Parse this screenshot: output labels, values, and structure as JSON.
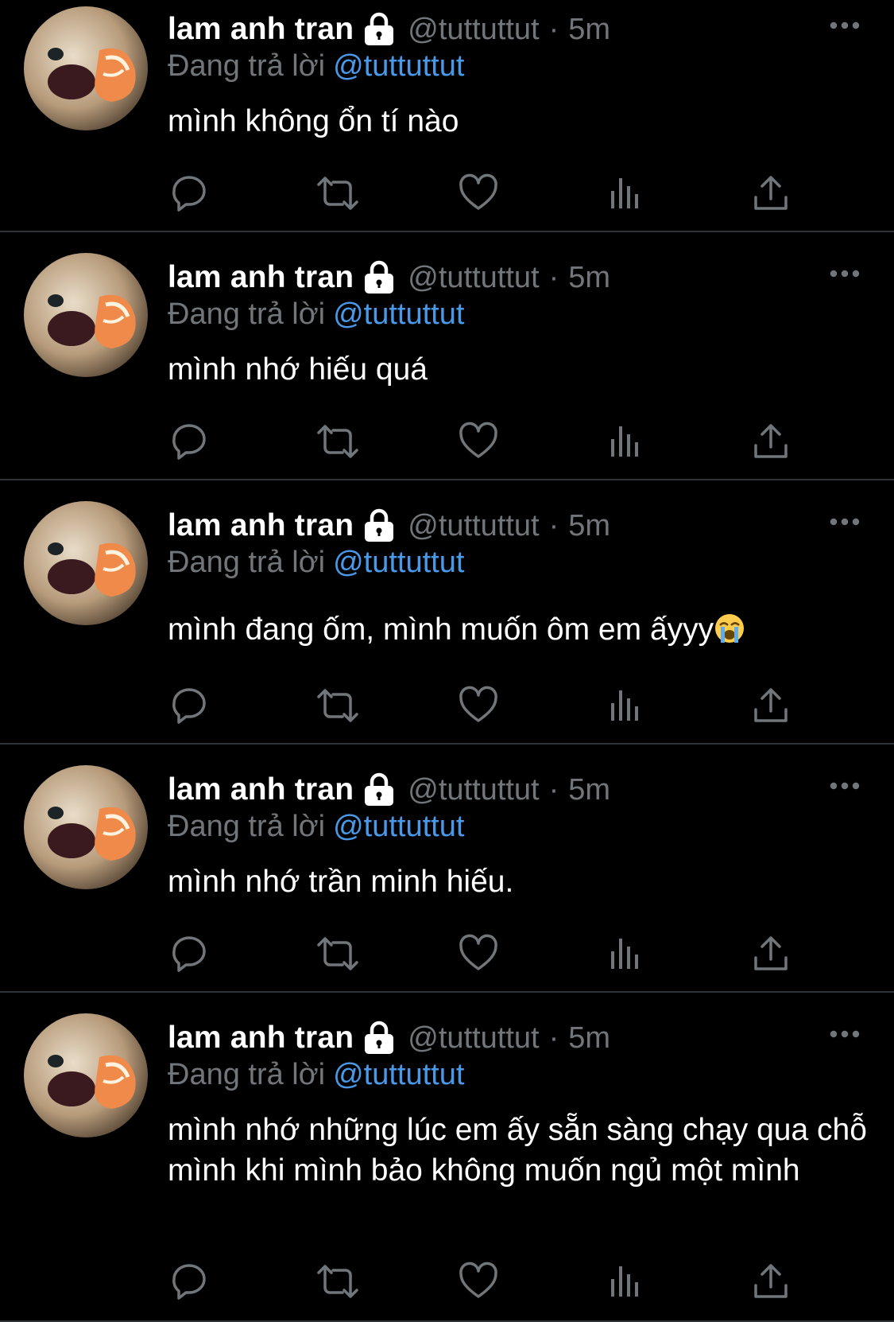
{
  "colors": {
    "background": "#000000",
    "text_primary": "#ffffff",
    "text_secondary": "#71767b",
    "link": "#4a99e9",
    "divider": "#2f3336"
  },
  "tweets": [
    {
      "display_name": "lam anh tran",
      "handle": "@tuttuttut",
      "separator": "·",
      "time": "5m",
      "reply_prefix": "Đang trả lời",
      "reply_to": "@tuttuttut",
      "text": "mình không ổn tí nào",
      "emoji": ""
    },
    {
      "display_name": "lam anh tran",
      "handle": "@tuttuttut",
      "separator": "·",
      "time": "5m",
      "reply_prefix": "Đang trả lời",
      "reply_to": "@tuttuttut",
      "text": "mình nhớ hiếu quá",
      "emoji": ""
    },
    {
      "display_name": "lam anh tran",
      "handle": "@tuttuttut",
      "separator": "·",
      "time": "5m",
      "reply_prefix": "Đang trả lời",
      "reply_to": "@tuttuttut",
      "text": "mình đang ốm, mình muốn ôm em ấyyy",
      "emoji": "loudly-crying-face"
    },
    {
      "display_name": "lam anh tran",
      "handle": "@tuttuttut",
      "separator": "·",
      "time": "5m",
      "reply_prefix": "Đang trả lời",
      "reply_to": "@tuttuttut",
      "text": "mình nhớ trần minh hiếu.",
      "emoji": ""
    },
    {
      "display_name": "lam anh tran",
      "handle": "@tuttuttut",
      "separator": "·",
      "time": "5m",
      "reply_prefix": "Đang trả lời",
      "reply_to": "@tuttuttut",
      "text": "mình nhớ những lúc em ấy sẵn sàng chạy qua chỗ mình khi mình bảo không muốn ngủ một mình",
      "emoji": ""
    }
  ],
  "icons": {
    "protected": "lock-icon",
    "more": "more-dots-icon",
    "reply": "reply-bubble-icon",
    "retweet": "retweet-icon",
    "like": "heart-icon",
    "views": "bar-chart-icon",
    "share": "share-upload-icon"
  }
}
